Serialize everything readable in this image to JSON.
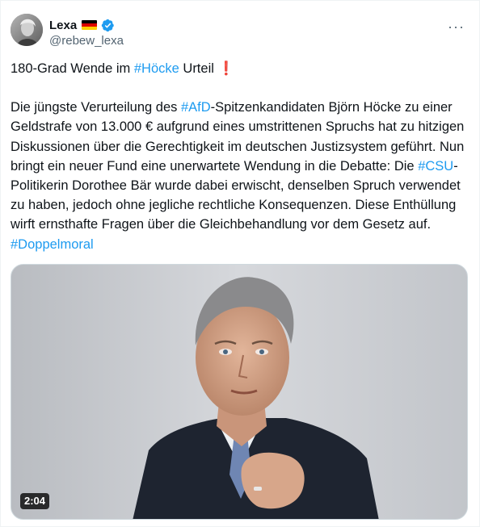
{
  "author": {
    "display_name": "Lexa",
    "handle": "@rebew_lexa",
    "avatar": "avatar-photo",
    "flag": "germany-flag-icon",
    "verified": "verified-badge-icon"
  },
  "more_menu": {
    "label": "···",
    "icon": "more-options-icon"
  },
  "tweet": {
    "line1_a": "180-Grad Wende im ",
    "line1_hashtag": "#Höcke",
    "line1_b": " Urteil ",
    "line1_emoji": "❗",
    "p2_a": "Die jüngste Verurteilung des ",
    "p2_hashtag1": "#AfD",
    "p2_b": "-Spitzenkandidaten Björn Höcke zu einer Geldstrafe von 13.000 € aufgrund eines umstrittenen Spruchs hat zu hitzigen Diskussionen über die Gerechtigkeit im deutschen Justizsystem geführt. Nun bringt ein neuer Fund eine unerwartete Wendung in die Debatte: Die ",
    "p2_hashtag2": "#CSU",
    "p2_c": "-Politikerin Dorothee Bär wurde dabei erwischt, denselben Spruch verwendet zu haben, jedoch ohne jegliche rechtliche Konsequenzen. Diese Enthüllung wirft ernsthafte Fragen über die Gleichbehandlung vor dem Gesetz auf. ",
    "p2_hashtag3": "#Doppelmoral"
  },
  "media": {
    "type": "video",
    "duration": "2:04"
  },
  "colors": {
    "link": "#1d9bf0",
    "text": "#0f1419",
    "secondary": "#536471",
    "verified": "#1d9bf0"
  }
}
